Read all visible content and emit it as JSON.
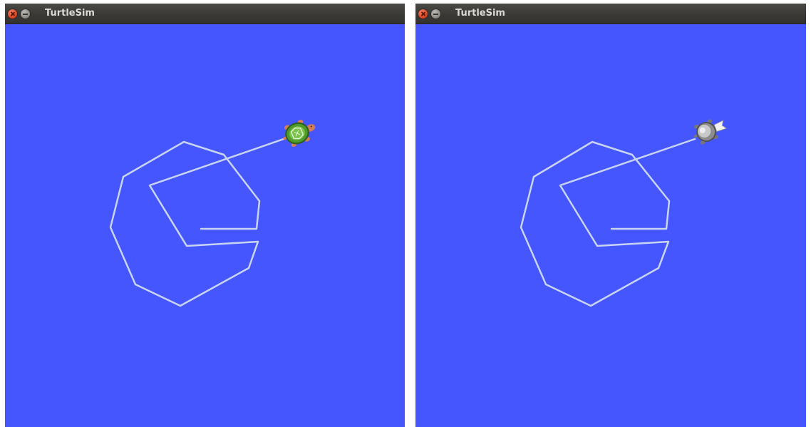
{
  "colors": {
    "background": "#4556ff",
    "pen": "#c8d4f4",
    "titlebar": "#3c3b37",
    "title_text": "#dcdad5"
  },
  "windows": [
    {
      "title": "TurtleSim",
      "turtle": "green-turtle-icon"
    },
    {
      "title": "TurtleSim",
      "turtle": "gray-turtle-icon"
    }
  ]
}
